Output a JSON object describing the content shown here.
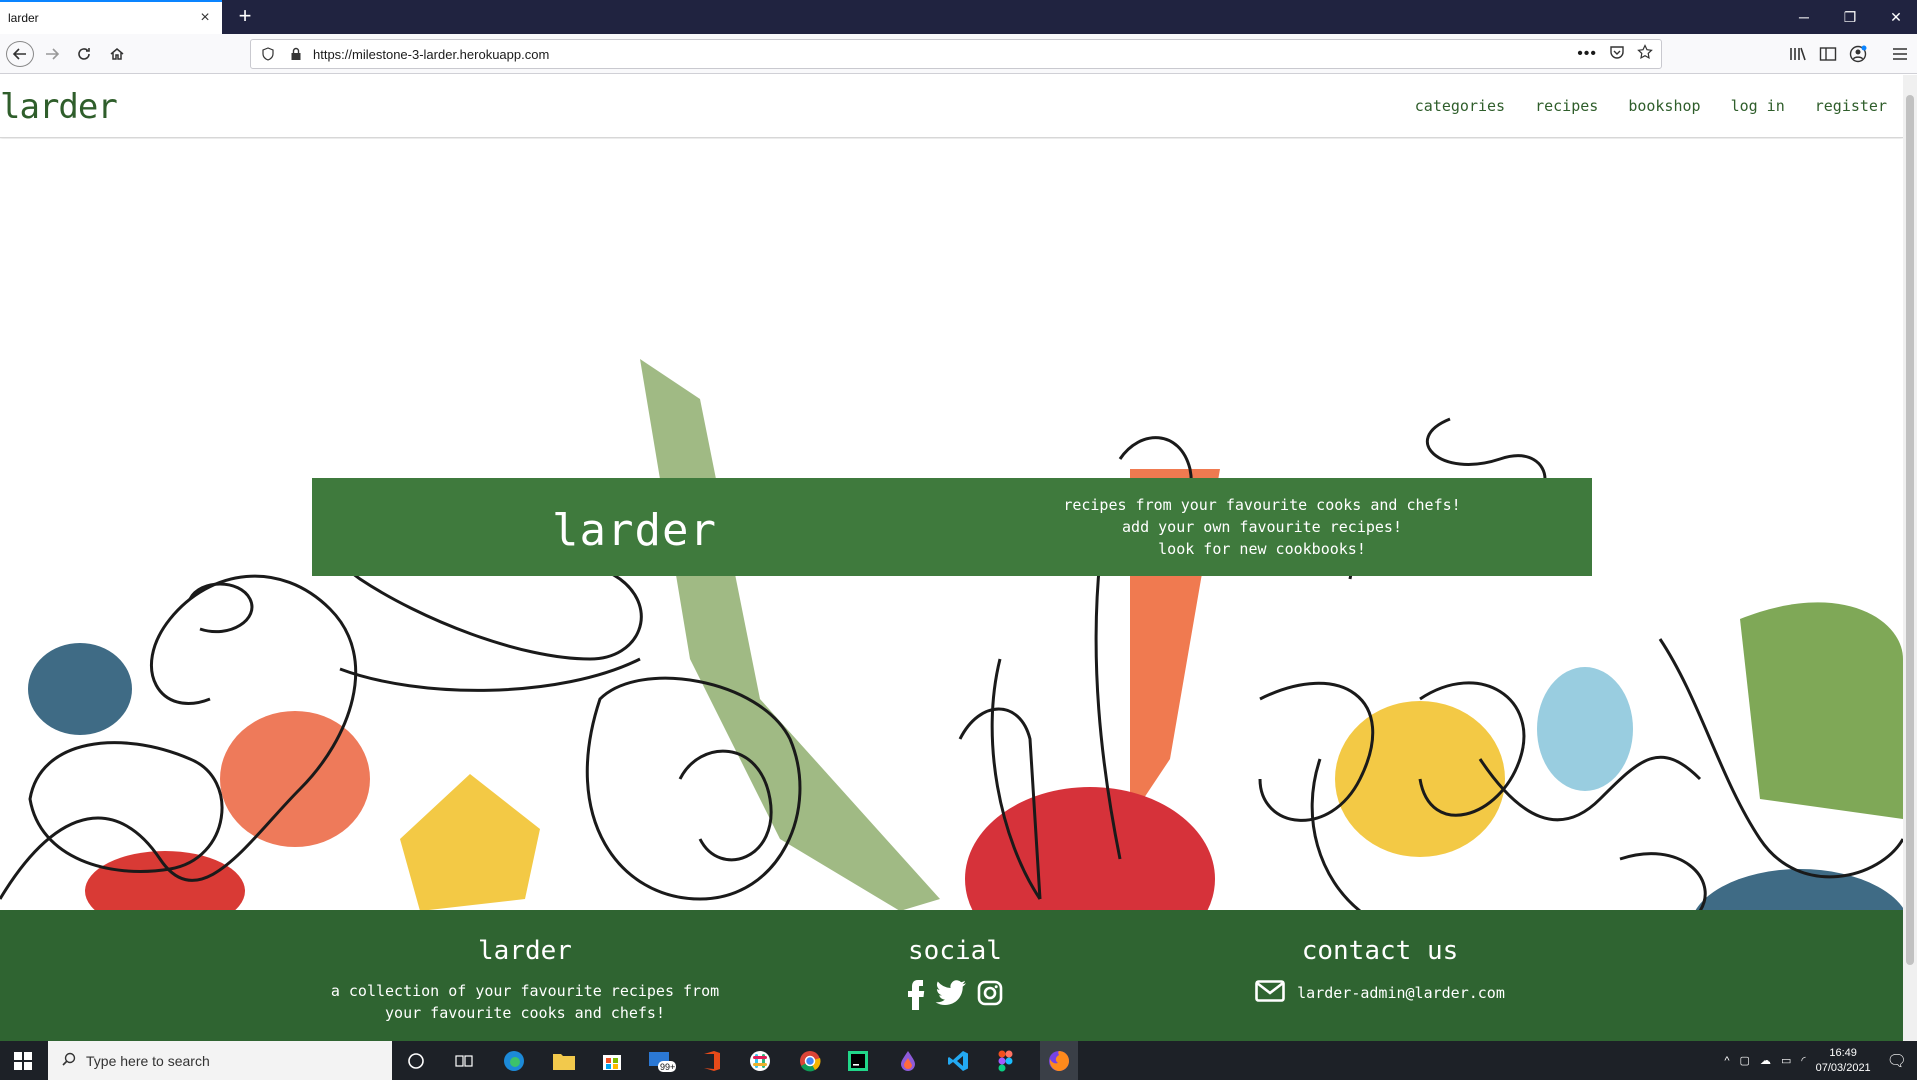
{
  "browser": {
    "tab_title": "larder",
    "url": "https://milestone-3-larder.herokuapp.com",
    "new_tab": "+"
  },
  "site": {
    "brand": "larder",
    "nav": [
      {
        "label": "categories"
      },
      {
        "label": "recipes"
      },
      {
        "label": "bookshop"
      },
      {
        "label": "log in"
      },
      {
        "label": "register"
      }
    ]
  },
  "hero": {
    "title": "larder",
    "lines": [
      "recipes from your favourite cooks and chefs!",
      "add your own favourite recipes!",
      "look for new cookbooks!"
    ]
  },
  "footer": {
    "about_title": "larder",
    "about_text": "a collection of your favourite recipes from your favourite cooks and chefs!",
    "social_title": "social",
    "social_icons": [
      "facebook-icon",
      "twitter-icon",
      "instagram-icon"
    ],
    "contact_title": "contact us",
    "contact_email": "larder-admin@larder.com"
  },
  "taskbar": {
    "search_placeholder": "Type here to search",
    "time": "16:49",
    "date": "07/03/2021",
    "mail_badge": "99+"
  },
  "colors": {
    "brand_green": "#2f5e2b",
    "banner_green": "#3f7a3d",
    "footer_green": "#2f6431",
    "titlebar": "#202340"
  }
}
